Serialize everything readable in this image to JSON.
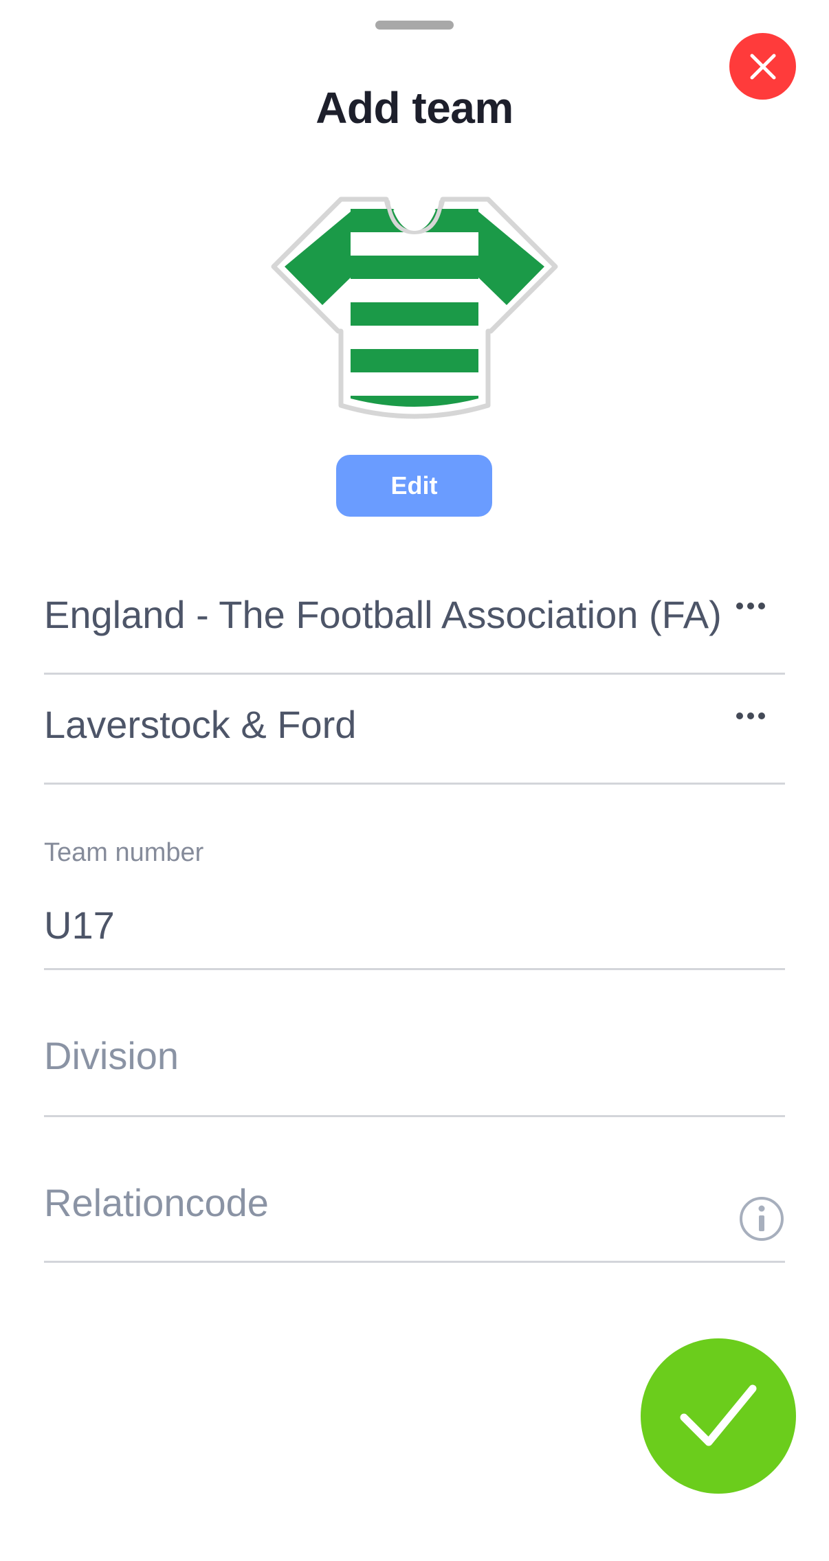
{
  "sheet": {
    "title": "Add team"
  },
  "icons": {
    "close": "close-icon",
    "shirt": "team-shirt-icon",
    "more": "more-horizontal-icon",
    "info": "info-icon",
    "confirm": "checkmark-icon"
  },
  "kit": {
    "edit_label": "Edit",
    "primary_color": "#1b9a48",
    "secondary_color": "#ffffff"
  },
  "form": {
    "association": {
      "value": "England - The Football Association (FA)"
    },
    "club": {
      "value": "Laverstock & Ford"
    },
    "team_number": {
      "label": "Team number",
      "value": "U17"
    },
    "division": {
      "placeholder": "Division"
    },
    "relationcode": {
      "placeholder": "Relationcode"
    }
  },
  "colors": {
    "close_button": "#ff3b3b",
    "confirm_button": "#6bcd1c",
    "edit_button": "#6a9cff"
  }
}
